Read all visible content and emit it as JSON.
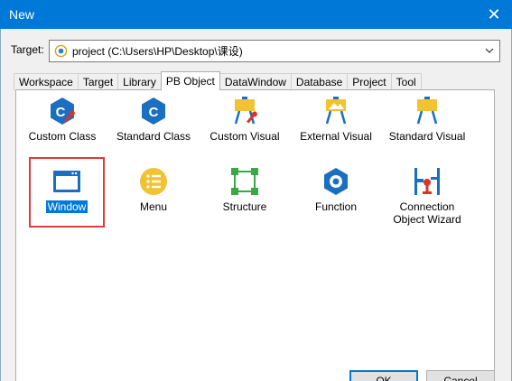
{
  "window": {
    "title": "New",
    "close_glyph": "✕"
  },
  "target": {
    "label": "Target:",
    "value": "project (C:\\Users\\HP\\Desktop\\课设)"
  },
  "tabs": [
    "Workspace",
    "Target",
    "Library",
    "PB Object",
    "DataWindow",
    "Database",
    "Project",
    "Tool"
  ],
  "active_tab": "PB Object",
  "items": [
    {
      "label": "Custom Class",
      "icon": "custom-class-icon"
    },
    {
      "label": "Standard Class",
      "icon": "standard-class-icon"
    },
    {
      "label": "Custom Visual",
      "icon": "custom-visual-icon"
    },
    {
      "label": "External Visual",
      "icon": "external-visual-icon"
    },
    {
      "label": "Standard Visual",
      "icon": "standard-visual-icon"
    },
    {
      "label": "Window",
      "icon": "window-icon",
      "selected": true
    },
    {
      "label": "Menu",
      "icon": "menu-icon"
    },
    {
      "label": "Structure",
      "icon": "structure-icon"
    },
    {
      "label": "Function",
      "icon": "function-icon"
    },
    {
      "label": "Connection Object Wizard",
      "icon": "connection-object-icon"
    }
  ],
  "buttons": {
    "ok": "OK",
    "cancel": "Cancel"
  },
  "colors": {
    "title_bar": "#0078d7",
    "selection": "#0078d7",
    "highlight_box": "#e03a3a",
    "icon_blue": "#1a6fc0",
    "icon_yellow": "#f2c230",
    "icon_red": "#d9332b",
    "icon_green": "#3aa845"
  }
}
